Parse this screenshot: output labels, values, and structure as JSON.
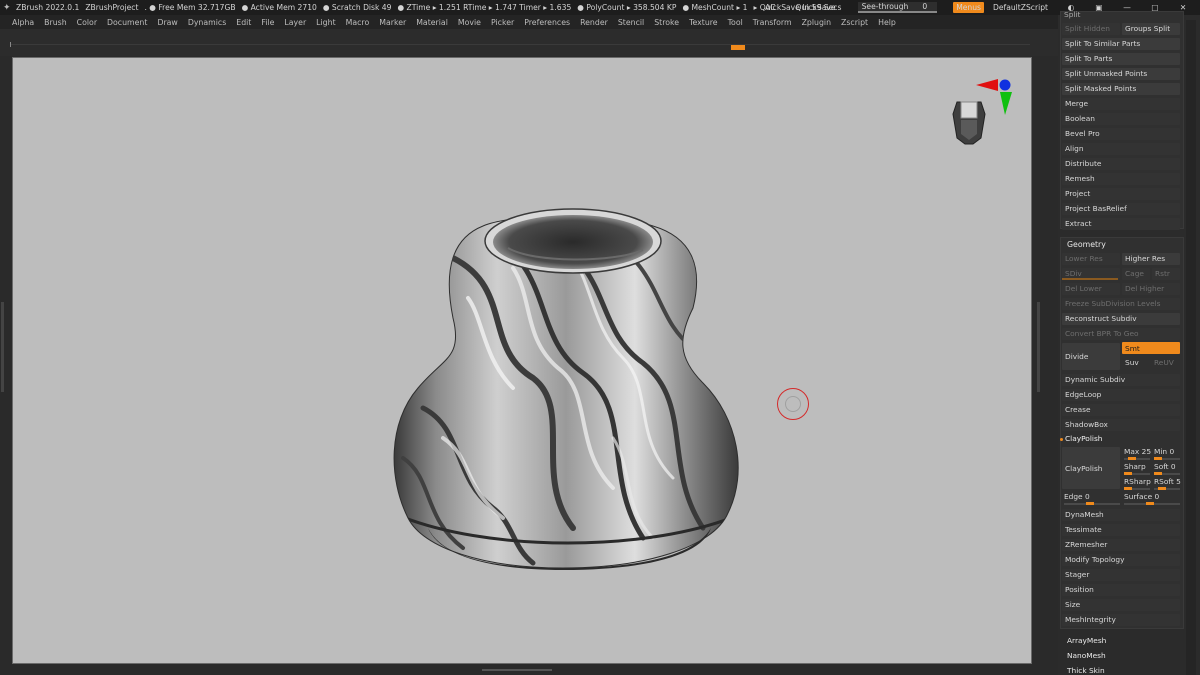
{
  "titlebar": {
    "app": "ZBrush 2022.0.1",
    "project": "ZBrushProject",
    "stats": [
      ". ● Free Mem 32.717GB",
      "● Active Mem 2710",
      "● Scratch Disk 49",
      "● ZTime ▸ 1.251 RTime ▸ 1.747 Timer ▸ 1.635",
      "● PolyCount ▸ 358.504 KP",
      "● MeshCount ▸ 1",
      "▸ QuickSave In 59 Secs"
    ],
    "ac": "AC",
    "quicksave": "QuickSave",
    "see_through_label": "See-through",
    "see_through_value": "0",
    "menus": "Menus",
    "script": "DefaultZScript"
  },
  "menubar": {
    "items": [
      "Alpha",
      "Brush",
      "Color",
      "Document",
      "Draw",
      "Dynamics",
      "Edit",
      "File",
      "Layer",
      "Light",
      "Macro",
      "Marker",
      "Material",
      "Movie",
      "Picker",
      "Preferences",
      "Render",
      "Stencil",
      "Stroke",
      "Texture",
      "Tool",
      "Transform",
      "Zplugin",
      "Zscript",
      "Help"
    ]
  },
  "subtool": {
    "split_header": "Split",
    "split_hidden": "Split Hidden",
    "groups_split": "Groups Split",
    "items": [
      "Split To Similar Parts",
      "Split To Parts",
      "Split Unmasked Points",
      "Split Masked Points",
      "Merge",
      "Boolean",
      "Bevel Pro",
      "Align",
      "Distribute",
      "Remesh",
      "Project",
      "Project BasRelief",
      "Extract"
    ]
  },
  "geometry": {
    "title": "Geometry",
    "lower_res": "Lower Res",
    "higher_res": "Higher Res",
    "sdiv": "SDiv",
    "cage": "Cage",
    "rstr": "Rstr",
    "del_lower": "Del Lower",
    "del_higher": "Del Higher",
    "freeze": "Freeze SubDivision Levels",
    "reconstruct": "Reconstruct Subdiv",
    "convert_bpr": "Convert BPR To Geo",
    "divide": "Divide",
    "smt": "Smt",
    "suv": "Suv",
    "reuv": "ReUV",
    "dynamic_subdiv": "Dynamic Subdiv",
    "edgeloop": "EdgeLoop",
    "crease": "Crease",
    "shadowbox": "ShadowBox",
    "claypolish_header": "ClayPolish",
    "claypolish_btn": "ClayPolish",
    "max_label": "Max 25",
    "min_label": "Min 0",
    "sharp_label": "Sharp",
    "soft_label": "Soft 0",
    "rsharp_label": "RSharp",
    "rsoft_label": "RSoft 5",
    "edge_label": "Edge 0",
    "surface_label": "Surface 0",
    "items_after": [
      "DynaMesh",
      "Tessimate",
      "ZRemesher",
      "Modify Topology",
      "Stager",
      "Position",
      "Size",
      "MeshIntegrity"
    ]
  },
  "panel_bottom": [
    "ArrayMesh",
    "NanoMesh",
    "Thick Skin"
  ],
  "colors": {
    "accent": "#f08a1c",
    "canvas_bg": "#bdbdbd",
    "gizmo_red": "#e01010",
    "gizmo_green": "#10c010",
    "gizmo_blue": "#1030e0"
  }
}
